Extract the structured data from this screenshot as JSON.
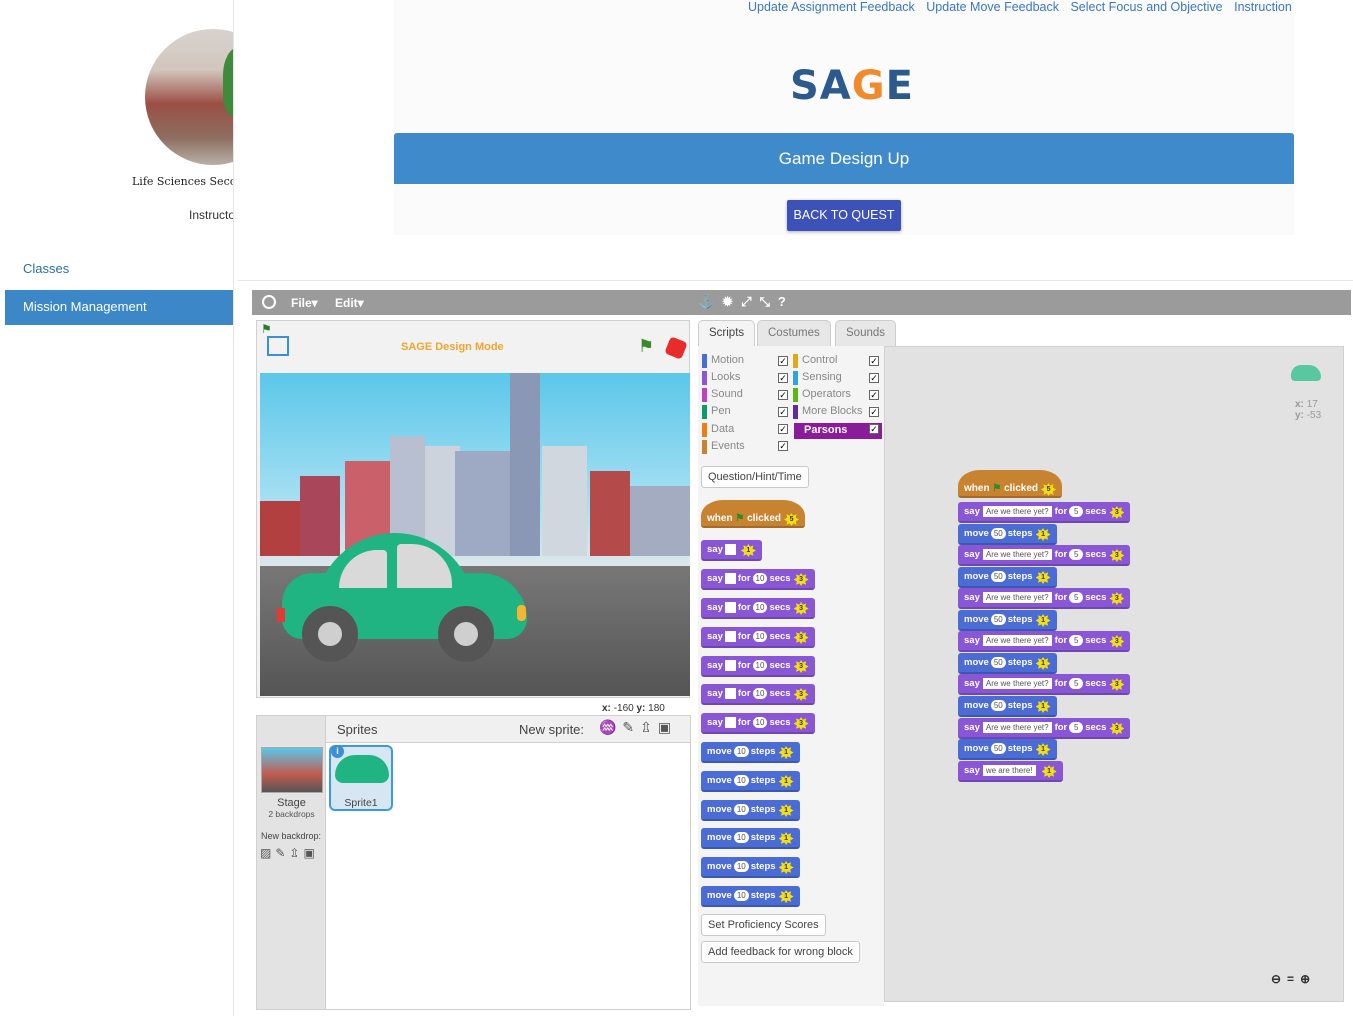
{
  "sidebar": {
    "school_caption": "Life Sciences Secondary School",
    "instructor_label": "Instructor",
    "nav": [
      {
        "label": "Classes"
      },
      {
        "label": "Mission Management"
      }
    ]
  },
  "topnav": {
    "links": [
      "Update Assignment Feedback",
      "Update Move Feedback",
      "Select Focus and Objective",
      "Instruction"
    ]
  },
  "header": {
    "logo_text_a": "SA",
    "logo_text_g": "G",
    "logo_text_e": "E",
    "quest_title": "Game Design Up",
    "back_button": "BACK TO QUEST"
  },
  "editor": {
    "menu": {
      "file": "File▾",
      "edit": "Edit▾",
      "tools": "⚓✹⤢⤡?"
    },
    "stage": {
      "mode_label": "SAGE Design Mode",
      "x_label": "x:",
      "x_value": "-160",
      "y_label": "y:",
      "y_value": "180"
    },
    "sprites": {
      "title": "Sprites",
      "new_sprite_label": "New sprite:",
      "new_sprite_icons": "♒✎⇫▣",
      "stage_name": "Stage",
      "stage_sub": "2 backdrops",
      "new_backdrop_label": "New backdrop:",
      "new_backdrop_icons": "▨✎⇫▣",
      "sprite1_name": "Sprite1",
      "info_glyph": "i"
    },
    "tabs": [
      "Scripts",
      "Costumes",
      "Sounds"
    ],
    "categories": [
      {
        "label": "Motion",
        "color": "#4a6cd4"
      },
      {
        "label": "Looks",
        "color": "#8a55d7"
      },
      {
        "label": "Sound",
        "color": "#bb42c3"
      },
      {
        "label": "Pen",
        "color": "#0e9a6c"
      },
      {
        "label": "Data",
        "color": "#ee7d16"
      },
      {
        "label": "Events",
        "color": "#c88330"
      },
      {
        "label": "Control",
        "color": "#e1a91a"
      },
      {
        "label": "Sensing",
        "color": "#2ca5e2"
      },
      {
        "label": "Operators",
        "color": "#5cb712"
      },
      {
        "label": "More Blocks",
        "color": "#632d99"
      },
      {
        "label": "Parsons",
        "color": "#8a1b9a"
      }
    ],
    "check_glyph": "✓",
    "palette_buttons": {
      "question": "Question/Hint/Time",
      "proficiency": "Set Proficiency Scores",
      "feedback": "Add feedback for wrong block"
    },
    "blocks": {
      "when": "when",
      "clicked": "clicked",
      "say": "say",
      "for": "for",
      "secs": "secs",
      "move": "move",
      "steps": "steps",
      "palette_n10": "10",
      "star1": "1",
      "star3": "3",
      "star5": "5",
      "script_msg": "Are we there yet?",
      "script_secs": "5",
      "script_steps": "50",
      "final_msg": "we are there!"
    },
    "script_area": {
      "x_label": "x:",
      "x_value": "17",
      "y_label": "y:",
      "y_value": "-53",
      "zoom_icons": "⊖=⊕"
    }
  }
}
